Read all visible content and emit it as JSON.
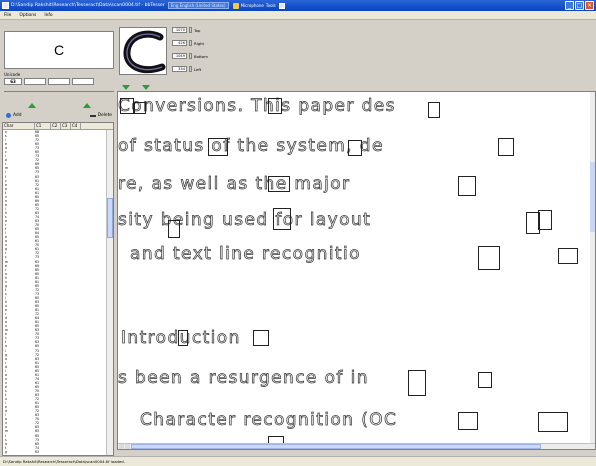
{
  "window": {
    "title": "D:\\Sandip Rakshit\\Research\\Tesseract\\Data\\scan0004.tif - bbTesser",
    "language": "Eng English (United States)",
    "tool_label": "Microphone",
    "tools_label": "Tools",
    "colors": {
      "titlebar": "#0a44c0",
      "accent_green": "#2e9a38",
      "panel": "#d4d0c8"
    }
  },
  "menu": {
    "file": "File",
    "options": "Options",
    "info": "Info"
  },
  "left": {
    "current_char": "C",
    "unicode_label": "Unicode",
    "unicode_value": "63",
    "add_label": "Add",
    "delete_label": "Delete",
    "table": {
      "headers": [
        "Char",
        "C1",
        "C2",
        "C3",
        "C4",
        ""
      ],
      "rows": [
        [
          "n",
          "68"
        ],
        [
          "s",
          "65"
        ],
        [
          "i",
          "72"
        ],
        [
          "e",
          "65"
        ],
        [
          "a",
          "73"
        ],
        [
          "c",
          "65"
        ],
        [
          "i",
          "73"
        ],
        [
          "o",
          "72"
        ],
        [
          "r",
          "69"
        ],
        [
          "m",
          "65"
        ],
        [
          "l",
          "73"
        ],
        [
          "f",
          "63"
        ],
        [
          "c",
          "61"
        ],
        [
          "e",
          "72"
        ],
        [
          "a",
          "61"
        ],
        [
          "t",
          "61"
        ],
        [
          "n",
          "65"
        ],
        [
          "n",
          "69"
        ],
        [
          "e",
          "65"
        ],
        [
          "l",
          "72"
        ],
        [
          "h",
          "63"
        ],
        [
          "s",
          "74"
        ],
        [
          "e",
          "63"
        ],
        [
          "r",
          "70"
        ],
        [
          "t",
          "65"
        ],
        [
          "l",
          "64"
        ],
        [
          "e",
          "65"
        ],
        [
          "a",
          "61"
        ],
        [
          "n",
          "70"
        ],
        [
          "g",
          "61"
        ],
        [
          "r",
          "72"
        ],
        [
          "c",
          "73"
        ],
        [
          "m",
          "63"
        ],
        [
          "e",
          "69"
        ],
        [
          "r",
          "65"
        ],
        [
          "o",
          "65"
        ],
        [
          "h",
          "61"
        ],
        [
          "n",
          "61"
        ],
        [
          "g",
          "65"
        ],
        [
          "t",
          "72"
        ],
        [
          "s",
          "73"
        ],
        [
          "i",
          "65"
        ],
        [
          "h",
          "63"
        ],
        [
          "u",
          "65"
        ],
        [
          "e",
          "61"
        ],
        [
          "r",
          "72"
        ],
        [
          "d",
          "64"
        ],
        [
          "o",
          "61"
        ],
        [
          "n",
          "65"
        ],
        [
          "m",
          "63"
        ],
        [
          "e",
          "70"
        ],
        [
          "c",
          "73"
        ],
        [
          "t",
          "63"
        ],
        [
          "o",
          "65"
        ],
        [
          "l",
          "73"
        ],
        [
          "g",
          "72"
        ],
        [
          "a",
          "63"
        ],
        [
          "r",
          "61"
        ],
        [
          "d",
          "65"
        ],
        [
          "i",
          "65"
        ],
        [
          "o",
          "61"
        ],
        [
          "n",
          "74"
        ],
        [
          "n",
          "61"
        ],
        [
          "e",
          "65"
        ],
        [
          "s",
          "70"
        ],
        [
          "t",
          "63"
        ],
        [
          "u",
          "72"
        ],
        [
          "i",
          "61"
        ],
        [
          "e",
          "65"
        ],
        [
          "d",
          "72"
        ],
        [
          "l",
          "63"
        ],
        [
          "o",
          "70"
        ],
        [
          "n",
          "72"
        ],
        [
          "a",
          "63"
        ],
        [
          "m",
          "65"
        ],
        [
          "r",
          "65"
        ],
        [
          "s",
          "73"
        ],
        [
          "a",
          "65"
        ],
        [
          "t",
          "74"
        ],
        [
          "g",
          "63"
        ]
      ]
    }
  },
  "box": {
    "top": "1070",
    "right": "426",
    "bottom": "1049",
    "left": "334",
    "top_label": "Top",
    "right_label": "Right",
    "bottom_label": "Bottom",
    "left_label": "Left"
  },
  "doc": {
    "lines": [
      "Conversions. This paper des",
      "of status of the system, de",
      "re, as well as the major",
      "sity being used for layout",
      "and text line recognitio",
      "Introduction",
      "s been a resurgence of in",
      "Character recognition (OC"
    ]
  },
  "status": {
    "text": "D:\\Sandip Rakshit\\Research\\Tesseract\\Data\\scan0004.tif loaded."
  }
}
